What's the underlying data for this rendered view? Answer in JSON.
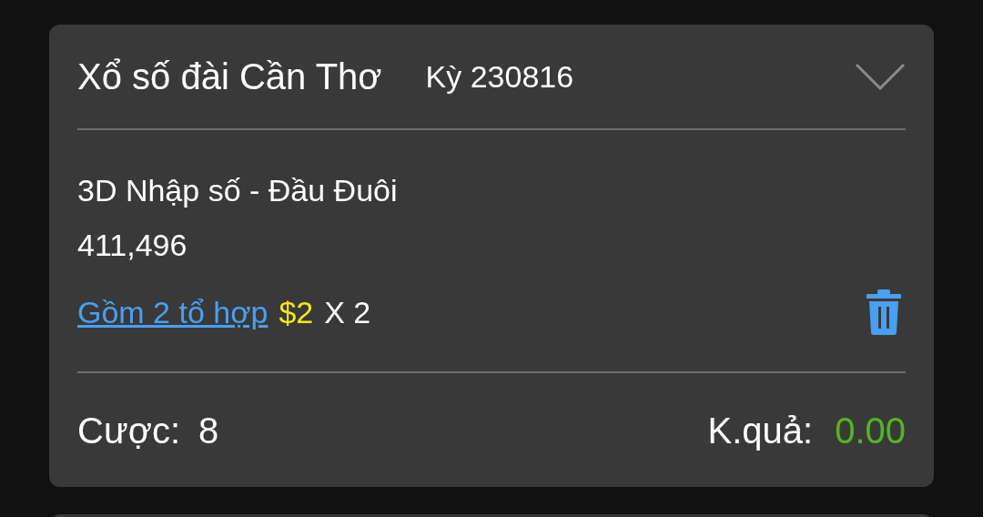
{
  "header": {
    "title": "Xổ số đài Cần Thơ",
    "period": "Kỳ 230816"
  },
  "bet": {
    "type": "3D Nhập số - Đầu Đuôi",
    "numbers": "411,496",
    "combo_link": "Gồm 2 tổ hợp",
    "amount": "$2",
    "multiplier": "X 2"
  },
  "footer": {
    "bet_label": "Cược:",
    "bet_value": "8",
    "result_label": "K.quả:",
    "result_value": "0.00"
  }
}
